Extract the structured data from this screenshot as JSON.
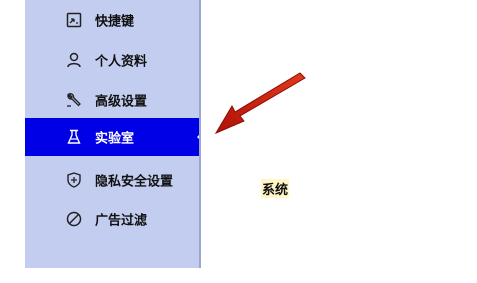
{
  "sidebar": {
    "items": [
      {
        "label": "快捷键",
        "icon": "shortcut-icon"
      },
      {
        "label": "个人资料",
        "icon": "user-icon"
      },
      {
        "label": "高级设置",
        "icon": "wrench-icon"
      },
      {
        "label": "实验室",
        "icon": "flask-icon",
        "active": true
      },
      {
        "label": "隐私安全设置",
        "icon": "shield-icon"
      },
      {
        "label": "广告过滤",
        "icon": "block-icon"
      }
    ]
  },
  "content": {
    "label": "系统"
  },
  "colors": {
    "sidebar_bg": "#c3cdf0",
    "active_bg": "#0000e6",
    "arrow": "#cc1a0a"
  }
}
